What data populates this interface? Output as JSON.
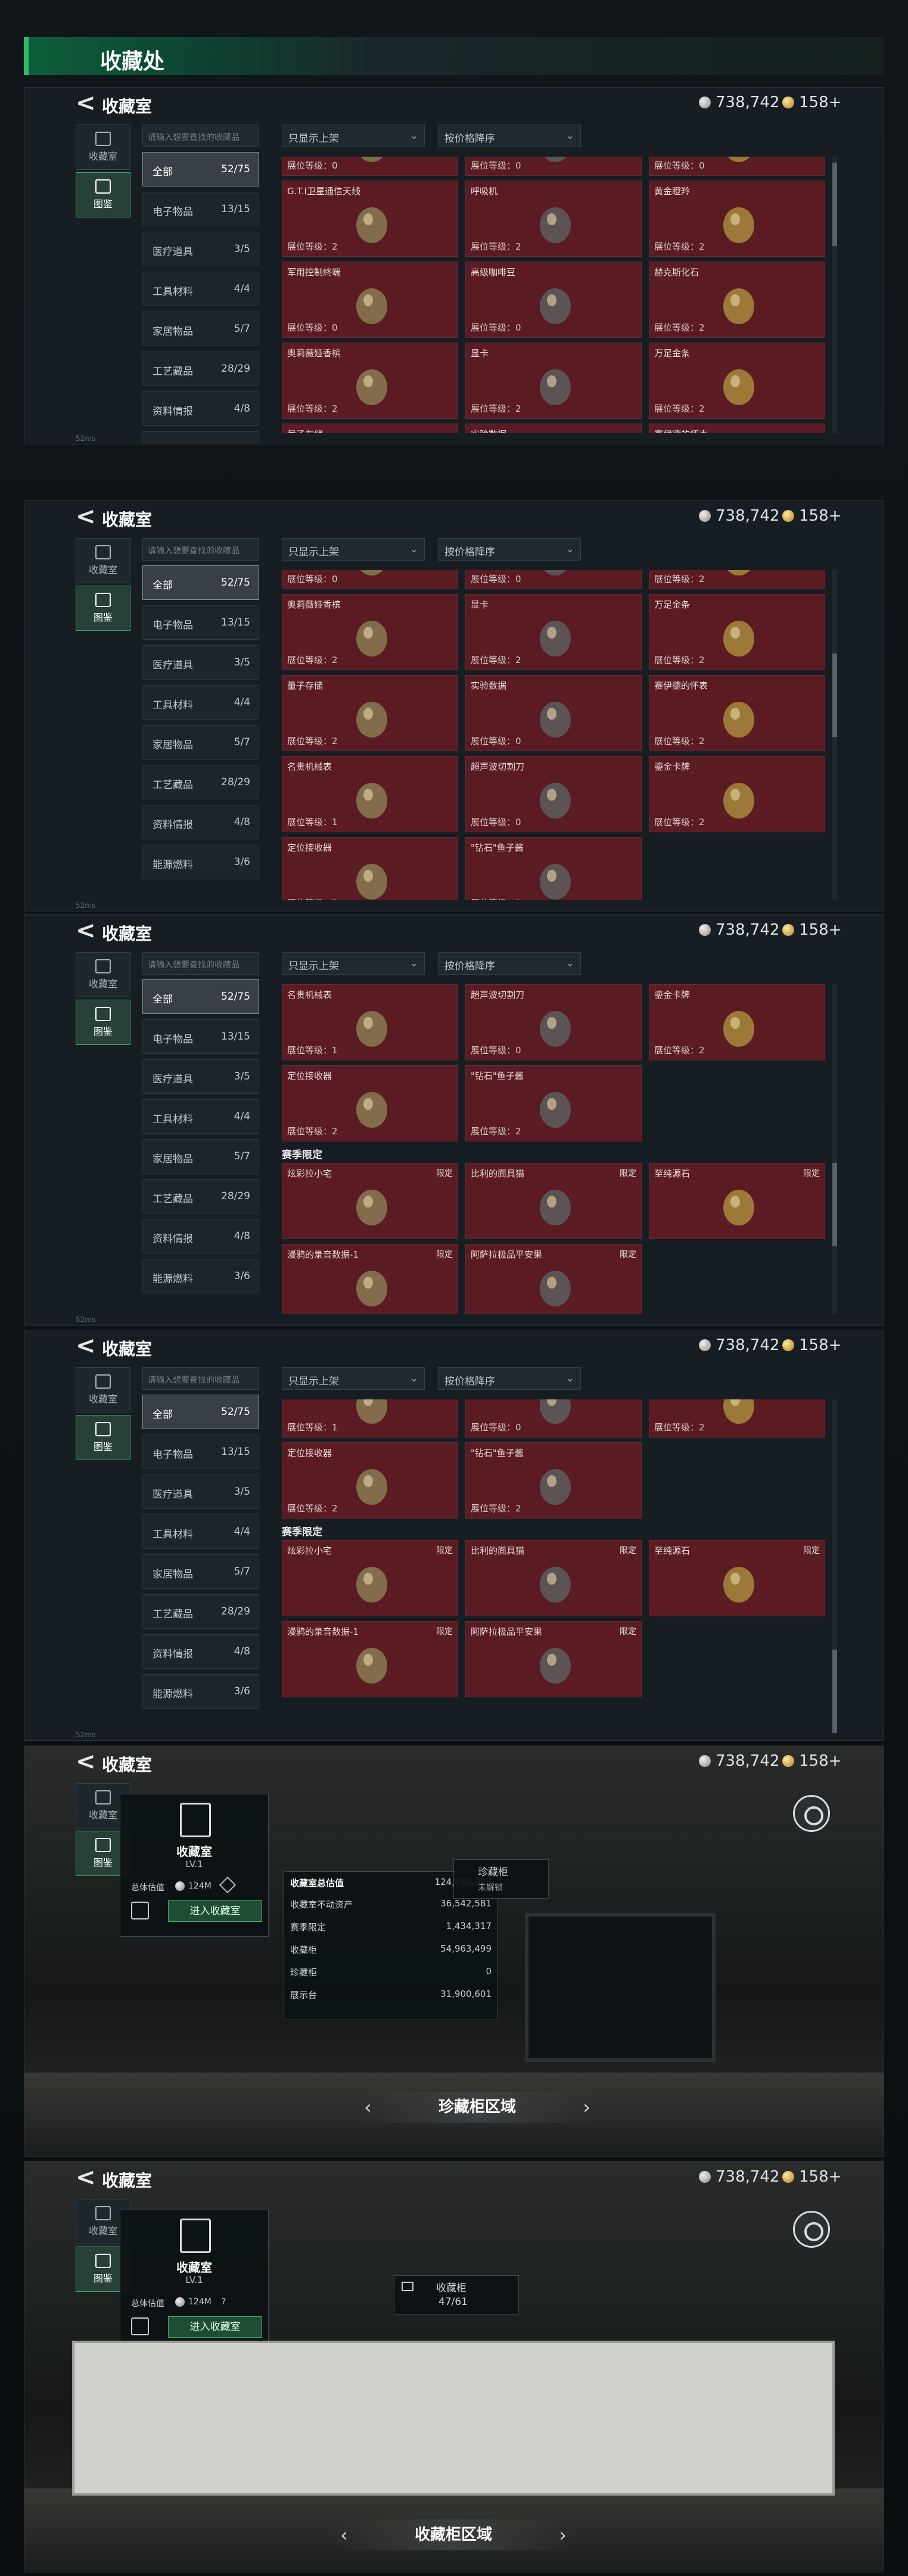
{
  "title": "收藏处",
  "header": {
    "back": "<",
    "title": "收藏室",
    "silver": "738,742",
    "gold": "158+"
  },
  "tabs": [
    "收藏室",
    "图鉴"
  ],
  "search_placeholder": "请输入想要查找的收藏品",
  "filter": {
    "shelf": "只显示上架",
    "sort": "按价格降序"
  },
  "categories": [
    {
      "label": "全部",
      "count": "52/75"
    },
    {
      "label": "电子物品",
      "count": "13/15"
    },
    {
      "label": "医疗道具",
      "count": "3/5"
    },
    {
      "label": "工具材料",
      "count": "4/4"
    },
    {
      "label": "家居物品",
      "count": "5/7"
    },
    {
      "label": "工艺藏品",
      "count": "28/29"
    },
    {
      "label": "资料情报",
      "count": "4/8"
    },
    {
      "label": "能源燃料",
      "count": "3/6"
    }
  ],
  "lv_prefix": "展位等级：",
  "items": [
    {
      "name": "G.T.I卫星通信天线",
      "level": "2"
    },
    {
      "name": "呼吸机",
      "level": "2"
    },
    {
      "name": "黄金瞪羚",
      "level": "2"
    },
    {
      "name": "军用控制终端",
      "level": "0"
    },
    {
      "name": "高级咖啡豆",
      "level": "0"
    },
    {
      "name": "赫克斯化石",
      "level": "2"
    },
    {
      "name": "奥莉薇娅香槟",
      "level": "2"
    },
    {
      "name": "显卡",
      "level": "2"
    },
    {
      "name": "万足金条",
      "level": "2"
    },
    {
      "name": "量子存储",
      "level": "2"
    },
    {
      "name": "实验数据",
      "level": "0"
    },
    {
      "name": "赛伊德的怀表",
      "level": "2"
    },
    {
      "name": "名贵机械表",
      "level": "1"
    },
    {
      "name": "超声波切割刀",
      "level": "0"
    },
    {
      "name": "鎏金卡牌",
      "level": "2"
    },
    {
      "name": "定位接收器",
      "level": "2"
    },
    {
      "name": "\"钻石\"鱼子酱",
      "level": "2"
    }
  ],
  "row0_lv": [
    "0",
    "0",
    "0"
  ],
  "season_title": "赛季限定",
  "season_tag": "限定",
  "season_items": [
    {
      "name": "炫彩拉小宅"
    },
    {
      "name": "比利的面具猫"
    },
    {
      "name": "至纯源石"
    },
    {
      "name": "漫鸦的录音数据-1"
    },
    {
      "name": "阿萨拉极品平安果"
    }
  ],
  "hall": {
    "title": "收藏室",
    "level": "LV.1",
    "value_label": "总体估值",
    "value": "124M",
    "enter": "进入收藏室",
    "stats_title": "收藏室总估值",
    "stats_total": "124,840,998",
    "stats": [
      {
        "label": "收藏室不动资产",
        "value": "36,542,581"
      },
      {
        "label": "赛季限定",
        "value": "1,434,317"
      },
      {
        "label": "收藏柜",
        "value": "54,963,499"
      },
      {
        "label": "珍藏柜",
        "value": "0"
      },
      {
        "label": "展示台",
        "value": "31,900,601"
      }
    ],
    "vault_title": "珍藏柜",
    "vault_status": "未解锁",
    "area1": "珍藏柜区域",
    "cabinet_title": "收藏柜",
    "cabinet_count": "47/61",
    "area2": "收藏柜区域",
    "help": "?"
  },
  "footer": "52ms"
}
